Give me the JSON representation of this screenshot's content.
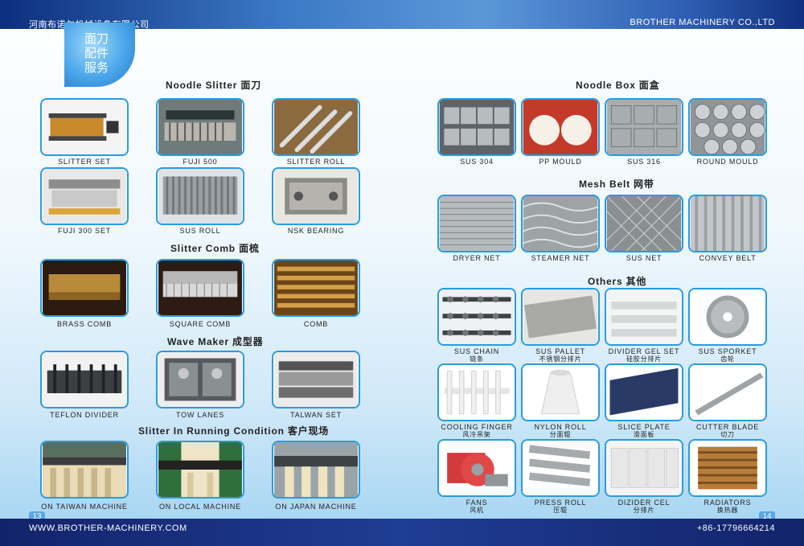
{
  "header": {
    "left_company": "河南布诺尔机械设备有限公司",
    "right_company": "BROTHER MACHINERY CO.,LTD"
  },
  "badge": {
    "line1": "面刀",
    "line2": "配件",
    "line3": "服务"
  },
  "footer": {
    "website": "WWW.BROTHER-MACHINERY.COM",
    "phone": "+86-17796664214",
    "page_left": "13",
    "page_right": "14"
  },
  "left_sections": {
    "noodle_slitter": "Noodle Slitter 面刀",
    "slitter_comb": "Slitter Comb 面梳",
    "wave_maker": "Wave Maker 成型器",
    "running": "Slitter In Running Condition 客户现场"
  },
  "right_sections": {
    "noodle_box": "Noodle Box 面盒",
    "mesh_belt": "Mesh Belt 网带",
    "others": "Others 其他"
  },
  "left_items": [
    {
      "label": "SLITTER SET"
    },
    {
      "label": "FUJI 500"
    },
    {
      "label": "SLITTER ROLL"
    },
    {
      "label": "FUJI 300 SET"
    },
    {
      "label": "SUS ROLL"
    },
    {
      "label": "NSK BEARING"
    },
    {
      "label": "BRASS COMB"
    },
    {
      "label": "SQUARE COMB"
    },
    {
      "label": "COMB"
    },
    {
      "label": "TEFLON DIVIDER"
    },
    {
      "label": "TOW LANES"
    },
    {
      "label": "TALWAN SET"
    },
    {
      "label": "ON TAIWAN MACHINE"
    },
    {
      "label": "ON LOCAL MACHINE"
    },
    {
      "label": "ON JAPAN MACHINE"
    }
  ],
  "right_items": [
    {
      "label": "SUS 304",
      "sub": ""
    },
    {
      "label": "PP MOULD",
      "sub": ""
    },
    {
      "label": "SUS 316",
      "sub": ""
    },
    {
      "label": "ROUND MOULD",
      "sub": ""
    },
    {
      "label": "DRYER NET",
      "sub": ""
    },
    {
      "label": "STEAMER NET",
      "sub": ""
    },
    {
      "label": "SUS NET",
      "sub": ""
    },
    {
      "label": "CONVEY BELT",
      "sub": ""
    },
    {
      "label": "SUS CHAIN",
      "sub": "链条"
    },
    {
      "label": "SUS PALLET",
      "sub": "不锈钢分排片"
    },
    {
      "label": "DIVIDER GEL SET",
      "sub": "硅胶分排片"
    },
    {
      "label": "SUS SPORKET",
      "sub": "齿轮"
    },
    {
      "label": "COOLING FINGER",
      "sub": "风冷吊架"
    },
    {
      "label": "NYLON ROLL",
      "sub": "分面辊"
    },
    {
      "label": "SLICE PLATE",
      "sub": "滑面板"
    },
    {
      "label": "CUTTER BLADE",
      "sub": "切刀"
    },
    {
      "label": "FANS",
      "sub": "风机"
    },
    {
      "label": "PRESS ROLL",
      "sub": "压辊"
    },
    {
      "label": "DIZIDER CEL",
      "sub": "分排片"
    },
    {
      "label": "RADIATORS",
      "sub": "换热器"
    }
  ]
}
